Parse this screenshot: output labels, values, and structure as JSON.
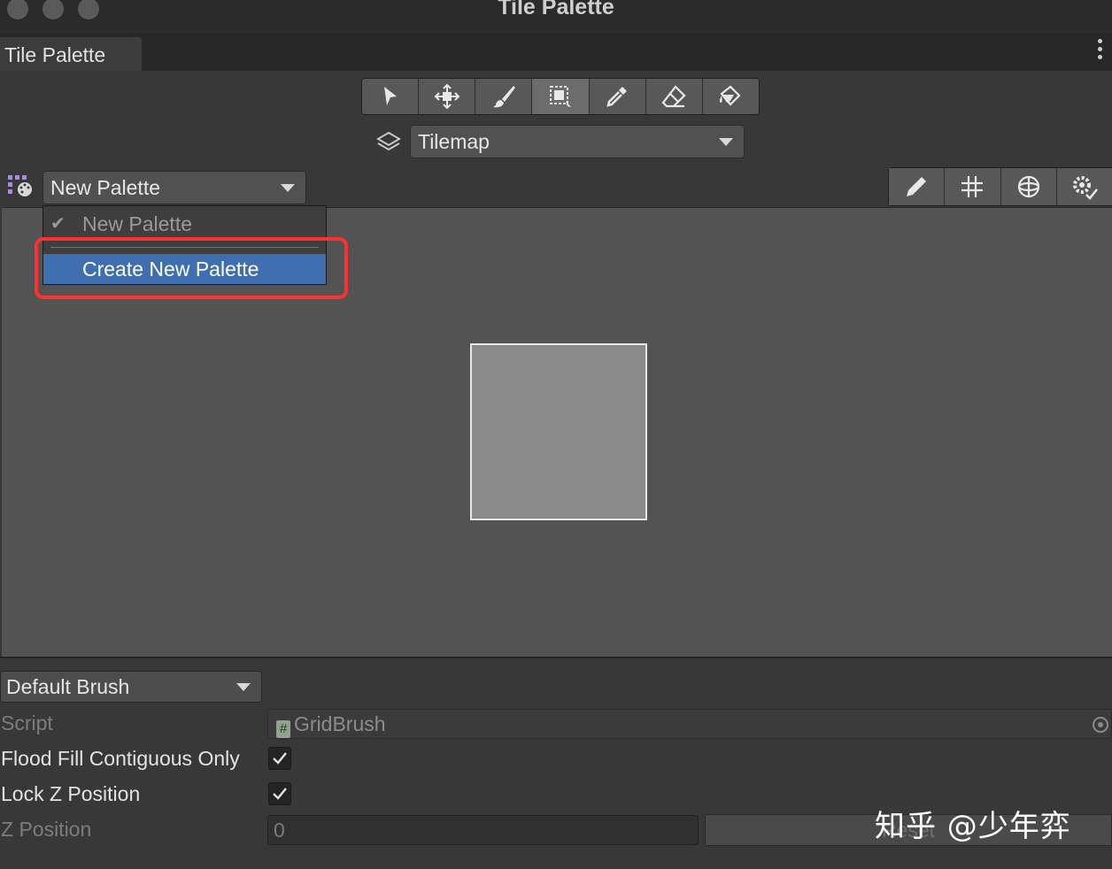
{
  "window": {
    "title": "Tile Palette"
  },
  "tab": {
    "label": "Tile Palette"
  },
  "toolbar": {
    "tools": [
      {
        "name": "select-tool",
        "icon": "arrow-pointer-icon"
      },
      {
        "name": "move-tool",
        "icon": "move-arrows-icon"
      },
      {
        "name": "paint-tool",
        "icon": "brush-icon"
      },
      {
        "name": "box-fill-tool",
        "icon": "box-select-icon",
        "active": true
      },
      {
        "name": "pick-tool",
        "icon": "eyedropper-icon"
      },
      {
        "name": "erase-tool",
        "icon": "eraser-icon"
      },
      {
        "name": "fill-tool",
        "icon": "paint-bucket-icon"
      }
    ]
  },
  "active_tilemap": {
    "value": "Tilemap"
  },
  "palette_select": {
    "value": "New Palette"
  },
  "palette_menu": {
    "items": [
      {
        "label": "New Palette",
        "checked": true,
        "enabled": false
      },
      {
        "label": "Create New Palette",
        "highlighted": true
      }
    ]
  },
  "palette_tools": [
    "pencil-icon",
    "grid-icon",
    "gizmo-icon",
    "settings-icon"
  ],
  "brush": {
    "select_value": "Default Brush",
    "script_label": "Script",
    "script_value": "GridBrush",
    "flood_fill_label": "Flood Fill Contiguous Only",
    "flood_fill_checked": true,
    "lock_z_label": "Lock Z Position",
    "lock_z_checked": true,
    "z_position_label": "Z Position",
    "z_position_value": "0",
    "reset_label": "Reset"
  },
  "watermark": {
    "text": "知乎 @少年弈"
  },
  "colors": {
    "highlight": "#3f6fb0",
    "annotation": "#ff3030",
    "background": "#383838"
  }
}
